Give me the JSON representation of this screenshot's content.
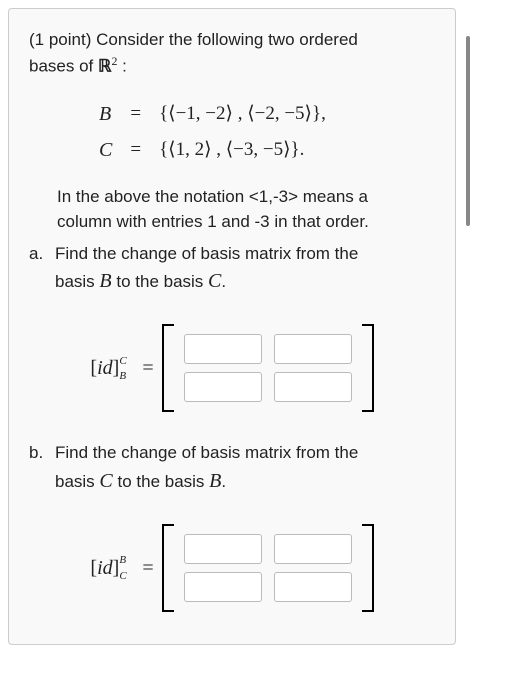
{
  "problem": {
    "points_prefix": "(1 point) ",
    "intro_line1": "Consider the following two ordered",
    "intro_line2_prefix": "bases of ",
    "space_symbol_html": "ℝ",
    "space_sup": "2",
    "colon": " :",
    "bases": {
      "B_name": "B",
      "B_eq": "=",
      "B_set": "{⟨−1, −2⟩ , ⟨−2, −5⟩},",
      "C_name": "C",
      "C_eq": "=",
      "C_set": "{⟨1, 2⟩ , ⟨−3, −5⟩}."
    },
    "notation_note_l1": "In the above the notation <1,-3> means a",
    "notation_note_l2": "column with entries 1 and -3 in that order.",
    "parts": {
      "a": {
        "label": "a.",
        "text_l1": "Find the change of basis matrix from the",
        "text_l2_prefix": "basis ",
        "text_l2_mid": " to the basis ",
        "text_l2_end": ".",
        "from": "B",
        "to": "C",
        "matrix_label_prefix": "[",
        "matrix_label_id": "id",
        "matrix_label_suffix": "]",
        "sup": "C",
        "sub": "B",
        "eq": "="
      },
      "b": {
        "label": "b.",
        "text_l1": "Find the change of basis matrix from the",
        "text_l2_prefix": "basis ",
        "text_l2_mid": " to the basis ",
        "text_l2_end": ".",
        "from": "C",
        "to": "B",
        "matrix_label_prefix": "[",
        "matrix_label_id": "id",
        "matrix_label_suffix": "]",
        "sup": "B",
        "sub": "C",
        "eq": "="
      }
    }
  }
}
